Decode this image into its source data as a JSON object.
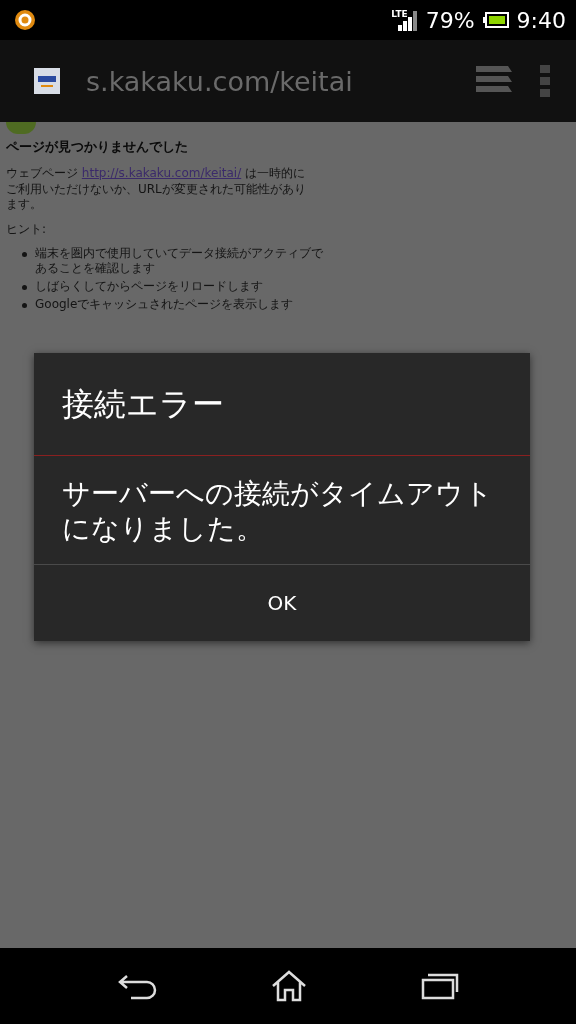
{
  "status_bar": {
    "network": "LTE",
    "battery": "79%",
    "time": "9:40"
  },
  "address_bar": {
    "url": "s.kakaku.com/keitai"
  },
  "page": {
    "heading": "ページが見つかりませんでした",
    "message": {
      "before": "ウェブページ ",
      "link": "http://s.kakaku.com/keitai/",
      "after": " は一時的にご利用いただけないか、URLが変更された可能性があります。"
    },
    "hints_label": "ヒント:",
    "hints": [
      "端末を圏内で使用していてデータ接続がアクティブであることを確認します",
      "しばらくしてからページをリロードします",
      "Googleでキャッシュされたページを表示します"
    ]
  },
  "dialog": {
    "title": "接続エラー",
    "message": "サーバーへの接続がタイムアウトになりました。",
    "button": "OK"
  }
}
